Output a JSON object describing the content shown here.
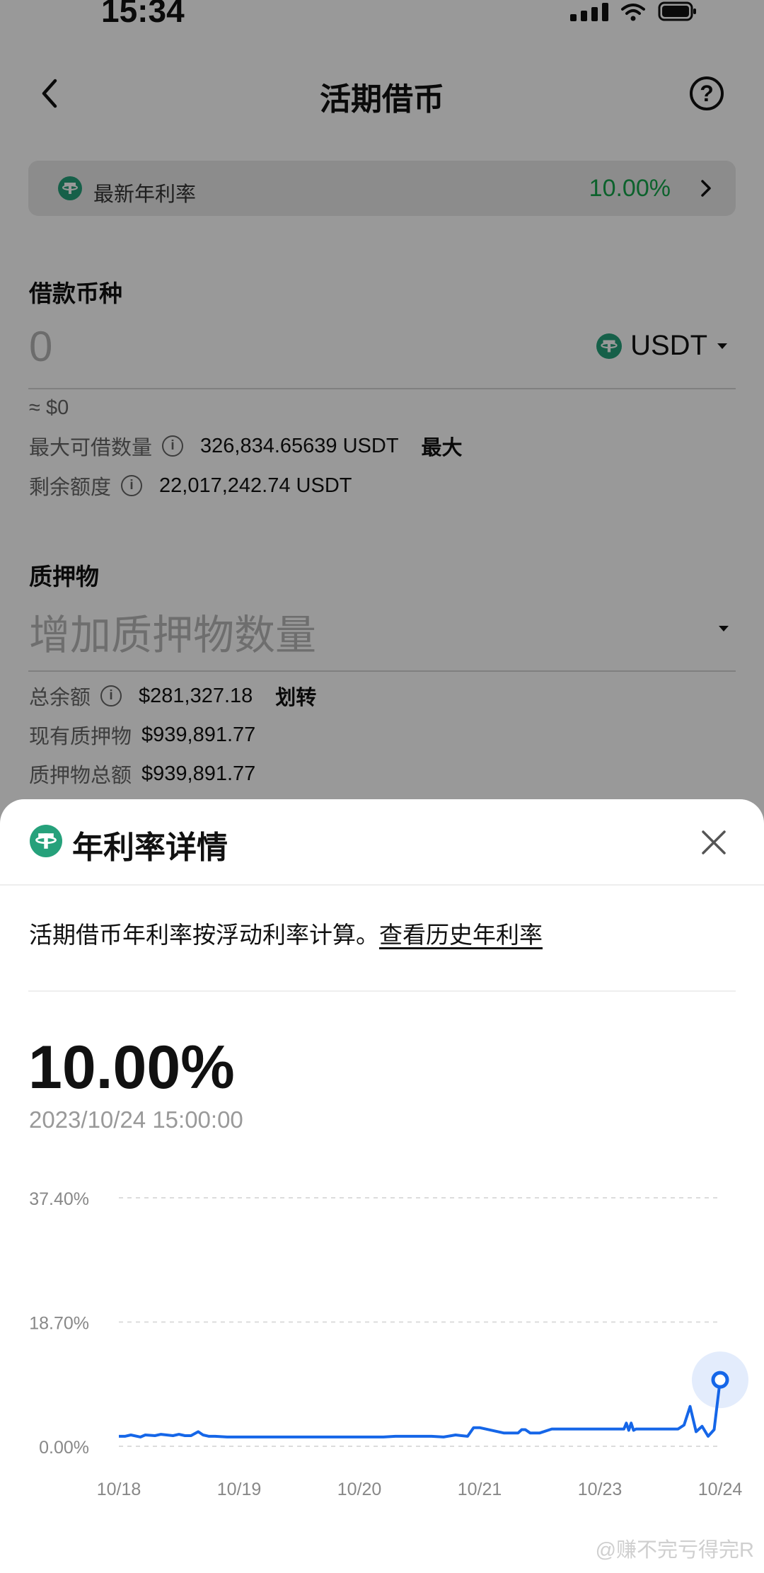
{
  "status_bar": {
    "time": "15:34"
  },
  "page": {
    "title": "活期借币",
    "help_icon": "question-circle-icon",
    "rate_banner": {
      "label": "最新年利率",
      "value": "10.00%"
    },
    "borrow": {
      "label": "借款币种",
      "amount_placeholder": "0",
      "currency": "USDT",
      "usd_value": "≈ $0",
      "max_label": "最大可借数量",
      "max_value": "326,834.65639 USDT",
      "max_button": "最大",
      "remaining_label": "剩余额度",
      "remaining_value": "22,017,242.74 USDT"
    },
    "collateral": {
      "label": "质押物",
      "placeholder": "增加质押物数量",
      "balance_label": "总余额",
      "balance_value": "$281,327.18",
      "transfer_button": "划转",
      "existing_label": "现有质押物",
      "existing_value": "$939,891.77",
      "total_label": "质押物总额",
      "total_value": "$939,891.77"
    }
  },
  "sheet": {
    "title": "年利率详情",
    "description": "活期借币年利率按浮动利率计算。",
    "history_link": "查看历史年利率",
    "current_rate": "10.00%",
    "timestamp": "2023/10/24 15:00:00"
  },
  "colors": {
    "green": "#14a34a",
    "tether": "#26a17b",
    "line": "#1566e8"
  },
  "watermark": "@赚不完亏得完R",
  "chart_data": {
    "type": "line",
    "y_ticks": [
      "37.40%",
      "18.70%",
      "0.00%"
    ],
    "x_ticks": [
      "10/18",
      "10/19",
      "10/20",
      "10/21",
      "10/23",
      "10/24"
    ],
    "ylim": [
      0,
      37.4
    ],
    "grid": true,
    "series": [
      {
        "x": [
          0,
          0.05,
          0.1,
          0.18,
          0.22,
          0.3,
          0.35,
          0.45,
          0.5,
          0.55,
          0.6,
          0.66,
          0.7,
          0.75,
          0.8,
          0.9,
          0.95,
          1.0,
          1.05,
          1.1,
          1.15,
          1.2,
          1.25,
          1.3,
          1.35,
          1.4,
          1.45,
          1.5,
          1.55,
          1.6,
          1.65,
          1.7,
          1.75,
          1.8,
          1.85,
          1.9,
          1.95,
          2.0,
          2.2,
          2.3,
          2.4,
          2.6,
          2.7,
          2.8,
          2.85,
          2.9,
          2.95,
          3.0,
          3.2,
          3.3,
          3.32,
          3.35,
          3.38,
          3.42,
          3.45,
          3.48,
          3.5,
          3.6,
          3.8,
          3.9,
          4.05,
          4.2,
          4.22,
          4.24,
          4.26,
          4.28,
          4.3,
          4.32,
          4.35,
          4.4,
          4.45,
          4.5,
          4.55,
          4.6,
          4.65,
          4.7,
          4.75,
          4.8,
          4.85,
          4.9,
          4.95,
          5.0
        ],
        "values": [
          1.5,
          1.5,
          1.7,
          1.4,
          1.7,
          1.6,
          1.8,
          1.6,
          1.8,
          1.6,
          1.6,
          2.2,
          1.7,
          1.5,
          1.5,
          1.4,
          1.4,
          1.4,
          1.4,
          1.4,
          1.4,
          1.4,
          1.4,
          1.4,
          1.4,
          1.4,
          1.4,
          1.4,
          1.4,
          1.4,
          1.4,
          1.4,
          1.4,
          1.4,
          1.4,
          1.4,
          1.4,
          1.4,
          1.4,
          1.5,
          1.5,
          1.5,
          1.4,
          1.7,
          1.6,
          1.5,
          2.8,
          2.8,
          2.0,
          2.0,
          2.0,
          2.5,
          2.5,
          2.0,
          2.0,
          2.0,
          2.0,
          2.6,
          2.6,
          2.6,
          2.6,
          2.6,
          3.5,
          2.4,
          3.5,
          2.4,
          2.6,
          2.6,
          2.6,
          2.6,
          2.6,
          2.6,
          2.6,
          2.6,
          2.6,
          3.2,
          6.0,
          2.2,
          3.0,
          1.5,
          2.5,
          10.0
        ]
      }
    ]
  }
}
